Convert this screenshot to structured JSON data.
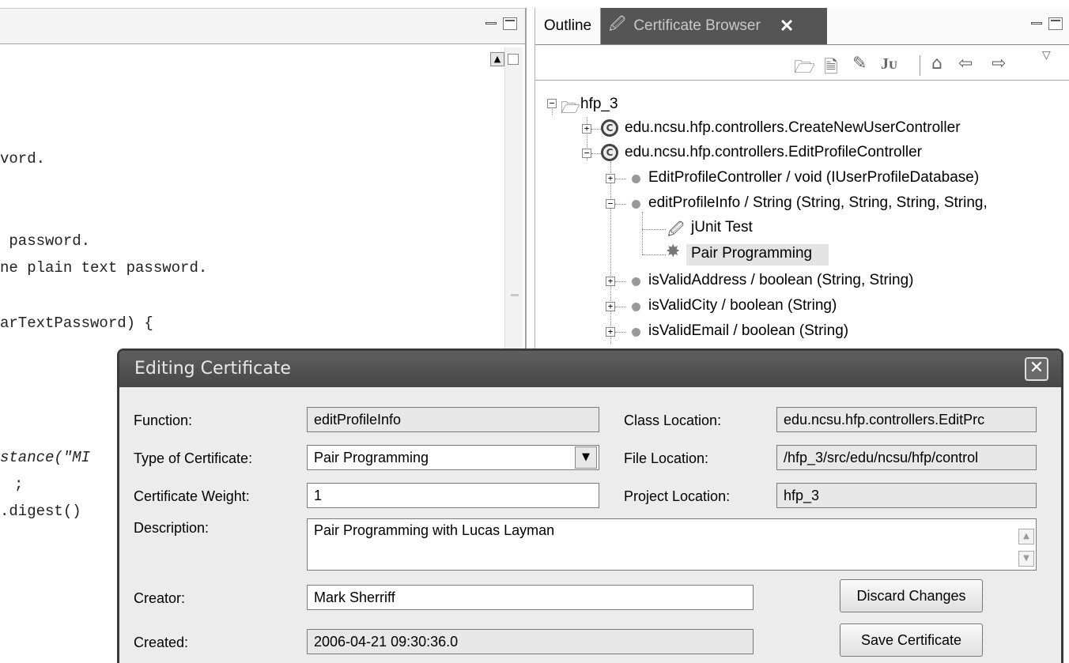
{
  "editor": {
    "code_lines": [
      "vord.",
      " password.",
      "ne plain text password.",
      "arTextPassword) {",
      "stance(\"MI",
      ";",
      ".digest()"
    ]
  },
  "right_panel": {
    "tabs": [
      {
        "label": "Outline"
      },
      {
        "label": "Certificate Browser",
        "close": "✕"
      }
    ],
    "tree": {
      "root": "hfp_3",
      "items": [
        {
          "label": "edu.ncsu.hfp.controllers.CreateNewUserController",
          "kind": "class",
          "expander": "+"
        },
        {
          "label": "edu.ncsu.hfp.controllers.EditProfileController",
          "kind": "class",
          "expander": "−"
        },
        {
          "label": "EditProfileController / void (IUserProfileDatabase)",
          "kind": "method",
          "expander": "+"
        },
        {
          "label": "editProfileInfo / String (String, String, String, String,",
          "kind": "method",
          "expander": "−"
        },
        {
          "label": "jUnit Test",
          "kind": "certificate"
        },
        {
          "label": "Pair Programming",
          "kind": "certificate"
        },
        {
          "label": "isValidAddress / boolean (String, String)",
          "kind": "method",
          "expander": "+"
        },
        {
          "label": "isValidCity / boolean (String)",
          "kind": "method",
          "expander": "+"
        },
        {
          "label": "isValidEmail / boolean (String)",
          "kind": "method",
          "expander": "+"
        }
      ]
    }
  },
  "dialog": {
    "title": "Editing Certificate",
    "close_glyph": "✕",
    "labels": {
      "function": "Function:",
      "type": "Type of Certificate:",
      "weight": "Certificate Weight:",
      "description": "Description:",
      "creator": "Creator:",
      "created": "Created:",
      "class_location": "Class Location:",
      "file_location": "File Location:",
      "project_location": "Project Location:"
    },
    "values": {
      "function": "editProfileInfo",
      "type": "Pair Programming",
      "weight": "1",
      "description": "Pair Programming with Lucas Layman",
      "creator": "Mark Sherriff",
      "created": "2006-04-21 09:30:36.0",
      "class_location": "edu.ncsu.hfp.controllers.EditPrc",
      "file_location": "/hfp_3/src/edu/ncsu/hfp/control",
      "project_location": "hfp_3"
    },
    "buttons": {
      "discard": "Discard Changes",
      "save": "Save Certificate"
    }
  }
}
